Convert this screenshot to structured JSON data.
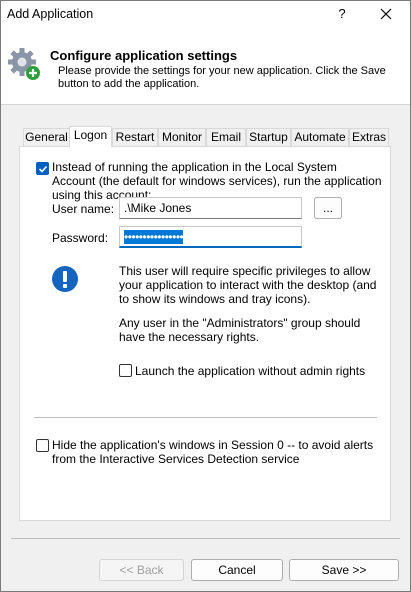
{
  "window": {
    "title": "Add Application",
    "help_label": "?",
    "close_icon": "close-icon"
  },
  "header": {
    "icon": "gear-plus-icon",
    "title": "Configure application settings",
    "description": "Please provide the settings for your new application. Click the Save button to add the application."
  },
  "tabs": [
    {
      "label": "General",
      "active": false
    },
    {
      "label": "Logon",
      "active": true
    },
    {
      "label": "Restart",
      "active": false
    },
    {
      "label": "Monitor",
      "active": false
    },
    {
      "label": "Email",
      "active": false
    },
    {
      "label": "Startup",
      "active": false
    },
    {
      "label": "Automate",
      "active": false
    },
    {
      "label": "Extras",
      "active": false
    }
  ],
  "logon": {
    "run_as_account_checked": true,
    "run_as_account_label": "Instead of running the application in the Local System Account (the default for windows services), run the application using this account:",
    "username_label": "User name:",
    "username_value": ".\\Mike Jones",
    "browse_label": "...",
    "password_label": "Password:",
    "password_value": "••••••••••••••••",
    "info_icon": "exclamation-icon",
    "info_text_1": "This user will require specific privileges to allow your application to interact with the desktop (and to show its windows and tray icons).",
    "info_text_2": "Any user in the \"Administrators\" group should have the necessary rights.",
    "launch_without_admin_checked": false,
    "launch_without_admin_label": "Launch the application without admin rights",
    "hide_session0_checked": false,
    "hide_session0_label": "Hide the application's windows in Session 0 -- to avoid alerts from the Interactive Services Detection service"
  },
  "footer": {
    "back_label": "<< Back",
    "cancel_label": "Cancel",
    "save_label": "Save >>"
  },
  "colors": {
    "accent": "#0078d7",
    "info_blue": "#1565c0"
  }
}
